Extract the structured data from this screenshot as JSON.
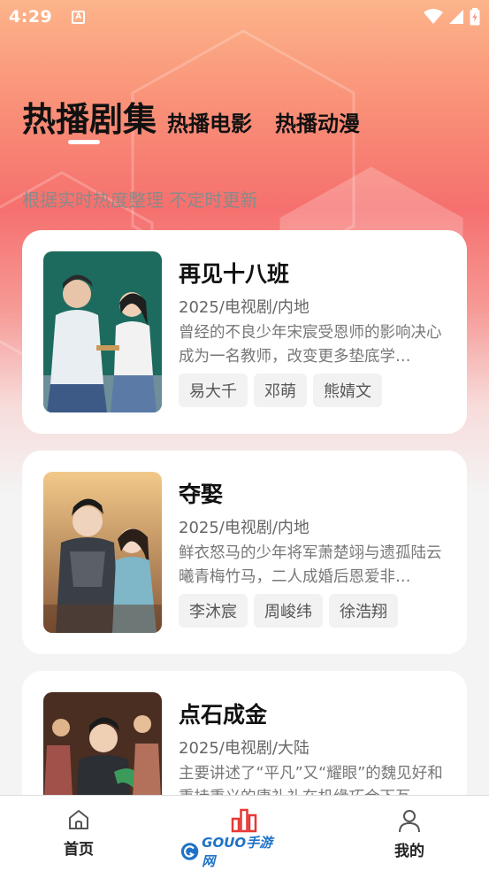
{
  "status_bar": {
    "time": "4:29",
    "notification_letter": "A"
  },
  "tabs": [
    {
      "label": "热播剧集",
      "active": true
    },
    {
      "label": "热播电影",
      "active": false
    },
    {
      "label": "热播动漫",
      "active": false
    }
  ],
  "subtitle": "根据实时热度整理 不定时更新",
  "cards": [
    {
      "title": "再见十八班",
      "meta": "2025/电视剧/内地",
      "description": "曾经的不良少年宋宸受恩师的影响决心成为一名教师，改变更多垫底学…",
      "tags": [
        "易大千",
        "邓萌",
        "熊婧文"
      ]
    },
    {
      "title": "夺娶",
      "meta": "2025/电视剧/内地",
      "description": "鲜衣怒马的少年将军萧楚翊与遗孤陆云曦青梅竹马，二人成婚后恩爱非…",
      "tags": [
        "李沐宸",
        "周峻纬",
        "徐浩翔"
      ]
    },
    {
      "title": "点石成金",
      "meta": "2025/电视剧/大陆",
      "description": "主要讲述了“平凡”又“耀眼”的魏见好和秉持秉义的唐礼礼在机缘巧合下互",
      "tags": []
    }
  ],
  "bottom_nav": [
    {
      "label": "首页",
      "icon": "home-icon"
    },
    {
      "label": "",
      "icon": "bar-chart-icon"
    },
    {
      "label": "我的",
      "icon": "user-icon"
    }
  ],
  "watermark": {
    "text": "GOUO手游网"
  },
  "colors": {
    "accent_red": "#e53935",
    "header_gradient_top": "#fcb48a",
    "header_gradient_mid": "#f5706e"
  }
}
